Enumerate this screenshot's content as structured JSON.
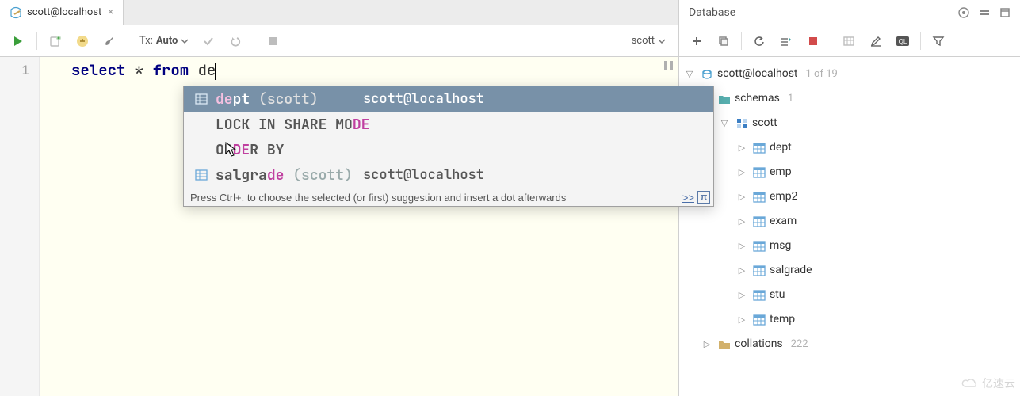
{
  "tab": {
    "title": "scott@localhost"
  },
  "toolbar": {
    "tx_label": "Tx:",
    "tx_value": "Auto",
    "schema": "scott"
  },
  "editor": {
    "line_number": "1",
    "kw_select": "select",
    "star": " * ",
    "kw_from": "from",
    "typed": " de"
  },
  "autocomplete": {
    "items": [
      {
        "pre": "de",
        "rest": "pt",
        "tail_dim": " (scott)",
        "right": "scott@localhost",
        "icon": "table",
        "selected": true
      },
      {
        "plain_pre": "LOCK IN SHARE MO",
        "match_tail": "DE",
        "right": "",
        "icon": "none"
      },
      {
        "plain_pre": "OR",
        "match_mid": "DE",
        "plain_post": "R BY",
        "right": "",
        "icon": "none"
      },
      {
        "plain_pre": "salgra",
        "match_tail": "de",
        "tail_dim": " (scott)",
        "right": "scott@localhost",
        "icon": "table"
      }
    ],
    "hint": "Press Ctrl+. to choose the selected (or first) suggestion and insert a dot afterwards",
    "hint_arrows": ">>",
    "hint_pi": "π"
  },
  "database": {
    "title": "Database",
    "root": {
      "label": "scott@localhost",
      "count": "1 of 19"
    },
    "schemas_label": "schemas",
    "schemas_count": "1",
    "schema_label": "scott",
    "tables": [
      "dept",
      "emp",
      "emp2",
      "exam",
      "msg",
      "salgrade",
      "stu",
      "temp"
    ],
    "collations_label": "collations",
    "collations_count": "222"
  },
  "watermark": "亿速云"
}
